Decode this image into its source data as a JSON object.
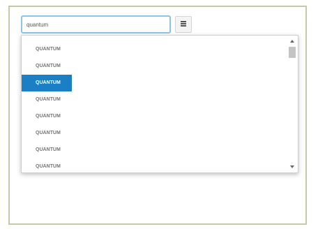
{
  "search": {
    "value": "quantum",
    "placeholder": ""
  },
  "menu_button": {
    "icon": "list-icon"
  },
  "dropdown": {
    "items": [
      {
        "label": "QUANTUM"
      },
      {
        "label": "QUANTUM"
      },
      {
        "label": "QUANTUM"
      },
      {
        "label": "QUANTUM"
      },
      {
        "label": "QUANTUM"
      },
      {
        "label": "QUANTUM"
      },
      {
        "label": "QUANTUM"
      },
      {
        "label": "QUANTUM"
      }
    ],
    "selected_index": 2
  },
  "colors": {
    "selected_bg": "#1a7fc4",
    "input_border": "#8cc3e6",
    "frame_border": "#c8c8a8"
  }
}
